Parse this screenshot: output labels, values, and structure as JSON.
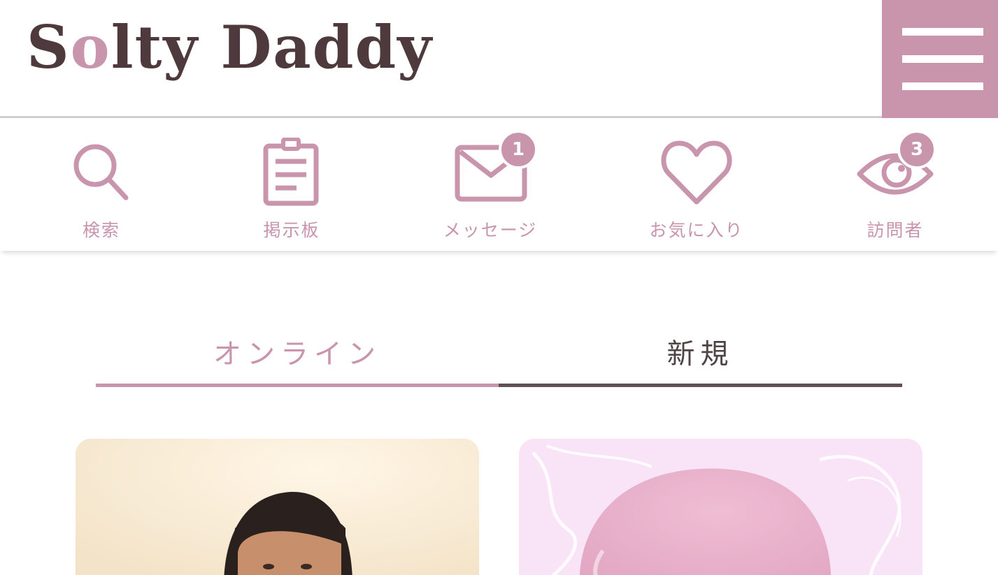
{
  "app": {
    "logo": {
      "part1": "S",
      "part2": "o",
      "part3": "lty Daddy"
    }
  },
  "colors": {
    "accent": "#c895ac",
    "dark": "#4e3a3d",
    "tab_active_line": "#5e5053"
  },
  "nav": {
    "items": [
      {
        "label": "検索",
        "icon": "search-icon"
      },
      {
        "label": "掲示板",
        "icon": "clipboard-icon"
      },
      {
        "label": "メッセージ",
        "icon": "envelope-icon",
        "badge": "1"
      },
      {
        "label": "お気に入り",
        "icon": "heart-icon"
      },
      {
        "label": "訪問者",
        "icon": "eye-icon",
        "badge": "3"
      }
    ]
  },
  "tabs": [
    {
      "label": "オンライン"
    },
    {
      "label": "新規",
      "selected": true
    }
  ],
  "cards": [
    {
      "type": "photo",
      "icon": "profile-photo"
    },
    {
      "type": "placeholder",
      "icon": "default-avatar-icon"
    }
  ]
}
